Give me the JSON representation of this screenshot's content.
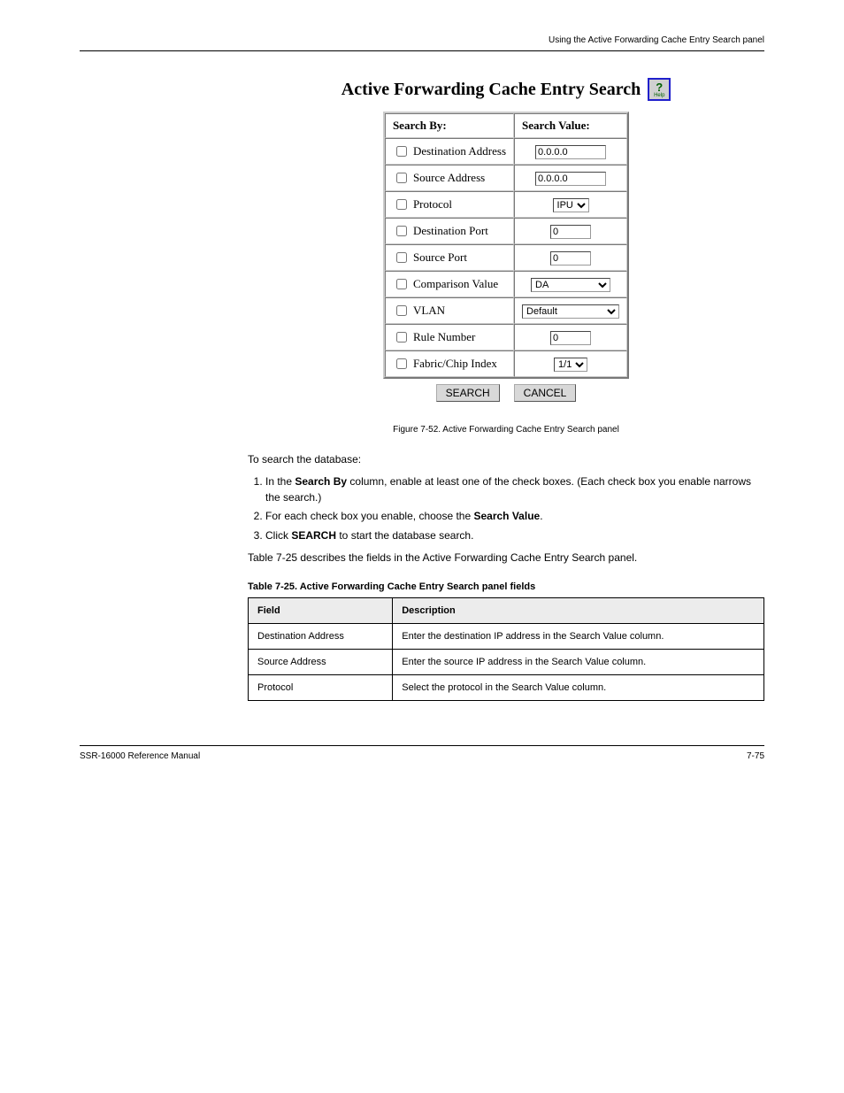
{
  "header_text": "Using the Active Forwarding Cache Entry Search panel",
  "panel_title": "Active Forwarding Cache Entry Search",
  "help_label": "Help",
  "form": {
    "header_searchby": "Search By:",
    "header_searchvalue": "Search Value:",
    "rows": [
      {
        "label": "Destination Address",
        "type": "text",
        "value": "0.0.0.0"
      },
      {
        "label": "Source Address",
        "type": "text",
        "value": "0.0.0.0"
      },
      {
        "label": "Protocol",
        "type": "select",
        "value": "IPU"
      },
      {
        "label": "Destination Port",
        "type": "text_narrow",
        "value": "0"
      },
      {
        "label": "Source Port",
        "type": "text_narrow",
        "value": "0"
      },
      {
        "label": "Comparison Value",
        "type": "select_wide",
        "value": "DA"
      },
      {
        "label": "VLAN",
        "type": "select_wide",
        "value": "Default"
      },
      {
        "label": "Rule Number",
        "type": "text_narrow",
        "value": "0"
      },
      {
        "label": "Fabric/Chip Index",
        "type": "select",
        "value": "1/1"
      }
    ]
  },
  "buttons": {
    "search": "SEARCH",
    "cancel": "CANCEL"
  },
  "caption": "Figure 7-52. Active Forwarding Cache Entry Search panel",
  "instructions": {
    "intro": "To search the database:",
    "step1_a": "In the ",
    "step1_b": "Search By",
    "step1_c": " column, enable at least one of the check boxes. (Each check box you enable narrows the search.)",
    "step2_a": "For each check box you enable, choose the ",
    "step2_b": "Search Value",
    "step2_c": ".",
    "step3_a": "Click ",
    "step3_b": "SEARCH",
    "step3_c": " to start the database search.",
    "note": "Table 7-25 describes the fields in the Active Forwarding Cache Entry Search panel."
  },
  "table_heading": "Table 7-25.   Active Forwarding Cache Entry Search panel fields",
  "fields_table": {
    "col1": "Field",
    "col2": "Description",
    "rows": [
      {
        "f": "Destination Address",
        "d": "Enter the destination IP address in the Search Value column."
      },
      {
        "f": "Source Address",
        "d": "Enter the source IP address in the Search Value column."
      },
      {
        "f": "Protocol",
        "d": "Select the protocol in the Search Value column."
      }
    ]
  },
  "footer": {
    "left": "SSR-16000 Reference Manual",
    "right": "7-75"
  }
}
